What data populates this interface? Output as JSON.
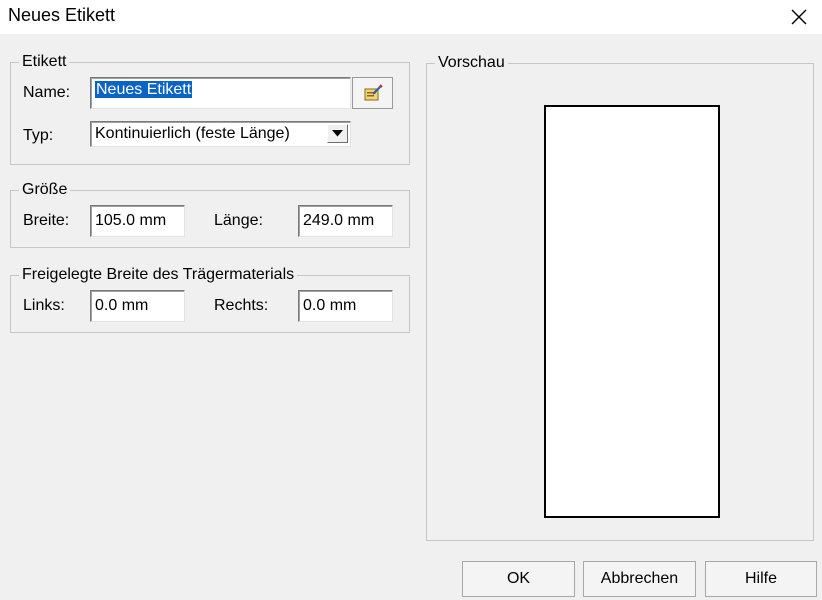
{
  "window": {
    "title": "Neues Etikett",
    "close_icon": "close-icon"
  },
  "etikett": {
    "legend": "Etikett",
    "name_label": "Name:",
    "name_value": "Neues Etikett",
    "name_button_icon": "edit-properties-icon",
    "type_label": "Typ:",
    "type_value": "Kontinuierlich (feste Länge)"
  },
  "groesse": {
    "legend": "Größe",
    "breite_label": "Breite:",
    "breite_value": "105.0 mm",
    "laenge_label": "Länge:",
    "laenge_value": "249.0 mm"
  },
  "traeger": {
    "legend": "Freigelegte Breite des Trägermaterials",
    "links_label": "Links:",
    "links_value": "0.0 mm",
    "rechts_label": "Rechts:",
    "rechts_value": "0.0 mm"
  },
  "preview": {
    "legend": "Vorschau"
  },
  "buttons": {
    "ok": "OK",
    "cancel": "Abbrechen",
    "help": "Hilfe"
  }
}
